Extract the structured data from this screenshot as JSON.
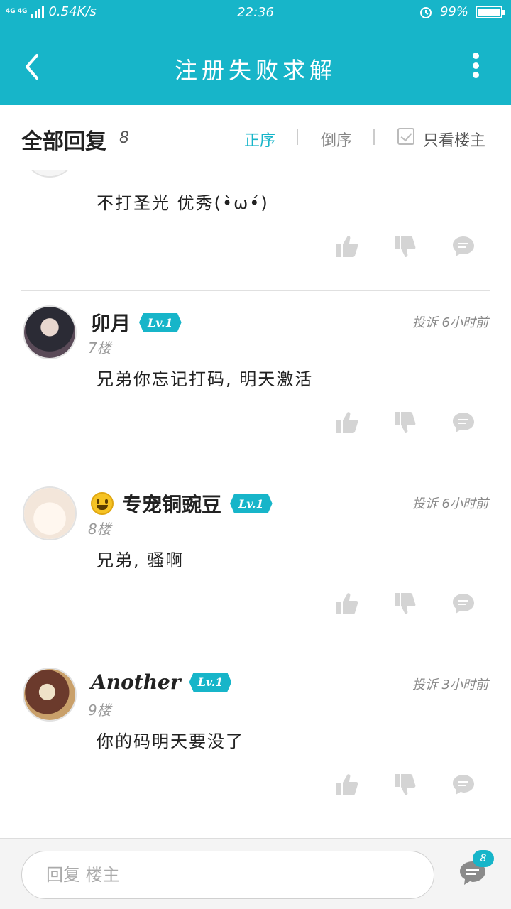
{
  "status_bar": {
    "network": "4G 4G",
    "speed": "0.54K/s",
    "time": "22:36",
    "battery_percent": "99%",
    "battery_level": 0.99
  },
  "header": {
    "title": "注册失败求解"
  },
  "subheader": {
    "all_replies": "全部回复",
    "count": "8",
    "sort_asc": "正序",
    "sort_desc": "倒序",
    "only_author": "只看楼主"
  },
  "posts": [
    {
      "content": "不打圣光 优秀(•̀ω•́)"
    },
    {
      "username": "卯月",
      "level": "Lv.1",
      "report": "投诉",
      "time": "6小时前",
      "floor": "7楼",
      "content": "兄弟你忘记打码, 明天激活"
    },
    {
      "username": "专宠铜豌豆",
      "level": "Lv.1",
      "report": "投诉",
      "time": "6小时前",
      "floor": "8楼",
      "content": "兄弟, 骚啊"
    },
    {
      "username": "Another",
      "level": "Lv.1",
      "report": "投诉",
      "time": "3小时前",
      "floor": "9楼",
      "content": "你的码明天要没了"
    }
  ],
  "footer": {
    "reply_placeholder": "回复 楼主",
    "comment_count": "8"
  },
  "colors": {
    "accent": "#17b5c9"
  }
}
